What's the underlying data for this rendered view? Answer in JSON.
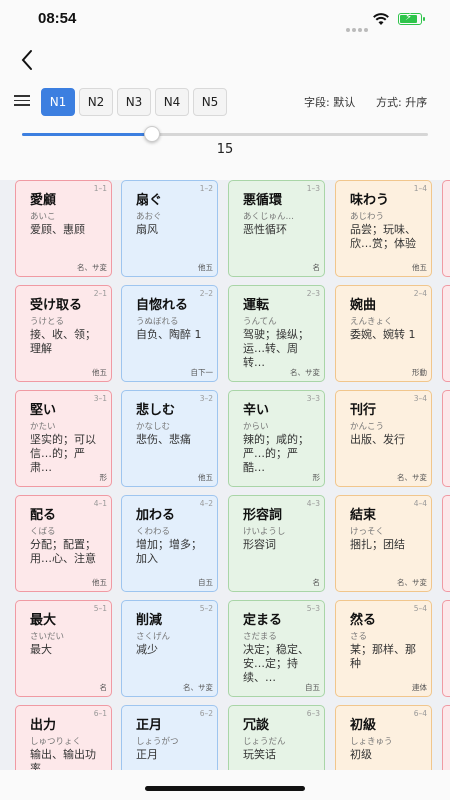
{
  "status": {
    "time": "08:54"
  },
  "toolbar": {
    "levels": [
      "N1",
      "N2",
      "N3",
      "N4",
      "N5"
    ],
    "active_level": "N1",
    "field_label": "字段: 默认",
    "order_label": "方式: 升序",
    "slider_fraction": 0.32,
    "slider_value": "15"
  },
  "colors": {
    "accent": "#3c7fe0",
    "red": "#f09aa3",
    "blue": "#9ec5ef",
    "green": "#a9d5a7",
    "orange": "#f1c68c"
  },
  "cards": [
    {
      "word": "愛顧",
      "reading": "あいこ",
      "meaning": "爱顾、惠顾",
      "id": "1–1",
      "pos": "名、サ変",
      "color": "red"
    },
    {
      "word": "扇ぐ",
      "reading": "あおぐ",
      "meaning": "扇风",
      "id": "1–2",
      "pos": "他五",
      "color": "blue"
    },
    {
      "word": "悪循環",
      "reading": "あくじゅん…",
      "meaning": "恶性循环",
      "id": "1–3",
      "pos": "名",
      "color": "green"
    },
    {
      "word": "味わう",
      "reading": "あじわう",
      "meaning": "品尝；玩味、欣…赏；体验",
      "id": "1–4",
      "pos": "他五",
      "color": "orange"
    },
    {
      "word": "受け取る",
      "reading": "うけとる",
      "meaning": "接、收、领；理解",
      "id": "2–1",
      "pos": "他五",
      "color": "red"
    },
    {
      "word": "自惚れる",
      "reading": "うぬぼれる",
      "meaning": "自负、陶醉 1",
      "id": "2–2",
      "pos": "自下一",
      "color": "blue"
    },
    {
      "word": "運転",
      "reading": "うんてん",
      "meaning": "驾驶；操纵；运…转、周转…",
      "id": "2–3",
      "pos": "名、サ変",
      "color": "green"
    },
    {
      "word": "婉曲",
      "reading": "えんきょく",
      "meaning": "委婉、婉转 1",
      "id": "2–4",
      "pos": "形動",
      "color": "orange"
    },
    {
      "word": "堅い",
      "reading": "かたい",
      "meaning": "坚实的；可以信…的；严肃…",
      "id": "3–1",
      "pos": "形",
      "color": "red"
    },
    {
      "word": "悲しむ",
      "reading": "かなしむ",
      "meaning": "悲伤、悲痛",
      "id": "3–2",
      "pos": "他五",
      "color": "blue"
    },
    {
      "word": "辛い",
      "reading": "からい",
      "meaning": "辣的；咸的；严…的；严酷…",
      "id": "3–3",
      "pos": "形",
      "color": "green"
    },
    {
      "word": "刊行",
      "reading": "かんこう",
      "meaning": "出版、发行",
      "id": "3–4",
      "pos": "名、サ変",
      "color": "orange"
    },
    {
      "word": "配る",
      "reading": "くばる",
      "meaning": "分配；配置；用…心、注意",
      "id": "4–1",
      "pos": "他五",
      "color": "red"
    },
    {
      "word": "加わる",
      "reading": "くわわる",
      "meaning": "增加；增多；加入",
      "id": "4–2",
      "pos": "自五",
      "color": "blue"
    },
    {
      "word": "形容詞",
      "reading": "けいようし",
      "meaning": "形容词",
      "id": "4–3",
      "pos": "名",
      "color": "green"
    },
    {
      "word": "結束",
      "reading": "けっそく",
      "meaning": "捆扎；团结",
      "id": "4–4",
      "pos": "名、サ変",
      "color": "orange"
    },
    {
      "word": "最大",
      "reading": "さいだい",
      "meaning": "最大",
      "id": "5–1",
      "pos": "名",
      "color": "red"
    },
    {
      "word": "削減",
      "reading": "さくげん",
      "meaning": "减少",
      "id": "5–2",
      "pos": "名、サ変",
      "color": "blue"
    },
    {
      "word": "定まる",
      "reading": "さだまる",
      "meaning": "决定；稳定、安…定；持续、…",
      "id": "5–3",
      "pos": "自五",
      "color": "green"
    },
    {
      "word": "然る",
      "reading": "さる",
      "meaning": "某；那样、那种",
      "id": "5–4",
      "pos": "連体",
      "color": "orange"
    },
    {
      "word": "出力",
      "reading": "しゅつりょく",
      "meaning": "输出、输出功率…",
      "id": "6–1",
      "pos": "",
      "color": "red"
    },
    {
      "word": "正月",
      "reading": "しょうがつ",
      "meaning": "正月",
      "id": "6–2",
      "pos": "",
      "color": "blue"
    },
    {
      "word": "冗談",
      "reading": "じょうだん",
      "meaning": "玩笑话",
      "id": "6–3",
      "pos": "",
      "color": "green"
    },
    {
      "word": "初級",
      "reading": "しょきゅう",
      "meaning": "初级",
      "id": "6–4",
      "pos": "",
      "color": "orange"
    }
  ]
}
